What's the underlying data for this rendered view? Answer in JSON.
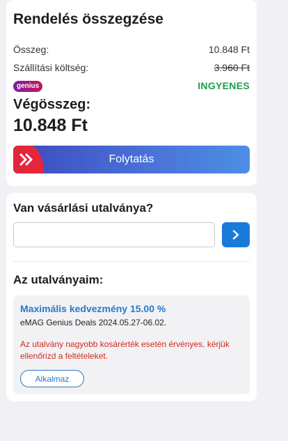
{
  "summary": {
    "title": "Rendelés összegzése",
    "subtotal_label": "Összeg:",
    "subtotal_value": "10.848 Ft",
    "shipping_label": "Szállítási költség:",
    "shipping_value": "3.960 Ft",
    "genius_badge": "genius",
    "shipping_free_label": "INGYENES",
    "total_label": "Végösszeg:",
    "total_value": "10.848 Ft",
    "continue_label": "Folytatás",
    "continue_icon": "double-chevron-right-icon"
  },
  "voucher": {
    "question": "Van vásárlási utalványa?",
    "input_value": "",
    "input_placeholder": "",
    "submit_icon": "chevron-right-icon",
    "my_vouchers_title": "Az utalványaim:",
    "items": [
      {
        "title": "Maximális kedvezmény 15.00 %",
        "subtitle": "eMAG Genius Deals 2024.05.27-06.02.",
        "note": "Az utalvány nagyobb kosárérték esetén érvényes, kérjük ellenőrizd a feltételeket.",
        "apply_label": "Alkalmaz"
      }
    ]
  },
  "colors": {
    "page_background": "#f1f1f5",
    "free_green": "#1e9e4a",
    "voucher_blue": "#2b79c7",
    "warning_red": "#d2281e",
    "submit_blue": "#1a7ad9",
    "continue_red": "#e3263b"
  }
}
